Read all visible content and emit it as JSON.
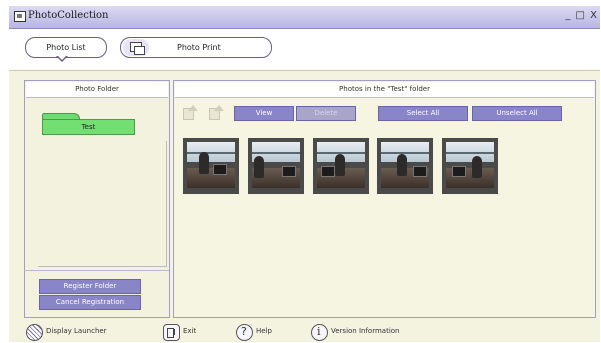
{
  "window": {
    "title": "PhotoCollection",
    "controls": "_ □ X"
  },
  "tabs": [
    {
      "label": "Photo List"
    },
    {
      "label": "Photo Print"
    }
  ],
  "left_panel": {
    "header": "Photo Folder",
    "folders": [
      {
        "label": "Test"
      }
    ],
    "buttons": {
      "register": "Register Folder",
      "cancel": "Cancel Registration"
    }
  },
  "right_panel": {
    "header": "Photos in the \"Test\" folder",
    "toolbar": {
      "view": "View",
      "delete": "Delete",
      "select_all": "Select All",
      "unselect_all": "Unselect All"
    },
    "photos": [
      {},
      {},
      {},
      {},
      {}
    ]
  },
  "footer": {
    "launcher": "Display Launcher",
    "exit": "Exit",
    "help": "Help",
    "version": "Version Information"
  },
  "colors": {
    "accent_button": "#8a84c8",
    "folder_green": "#73df73",
    "panel_bg": "#f4f3df"
  }
}
